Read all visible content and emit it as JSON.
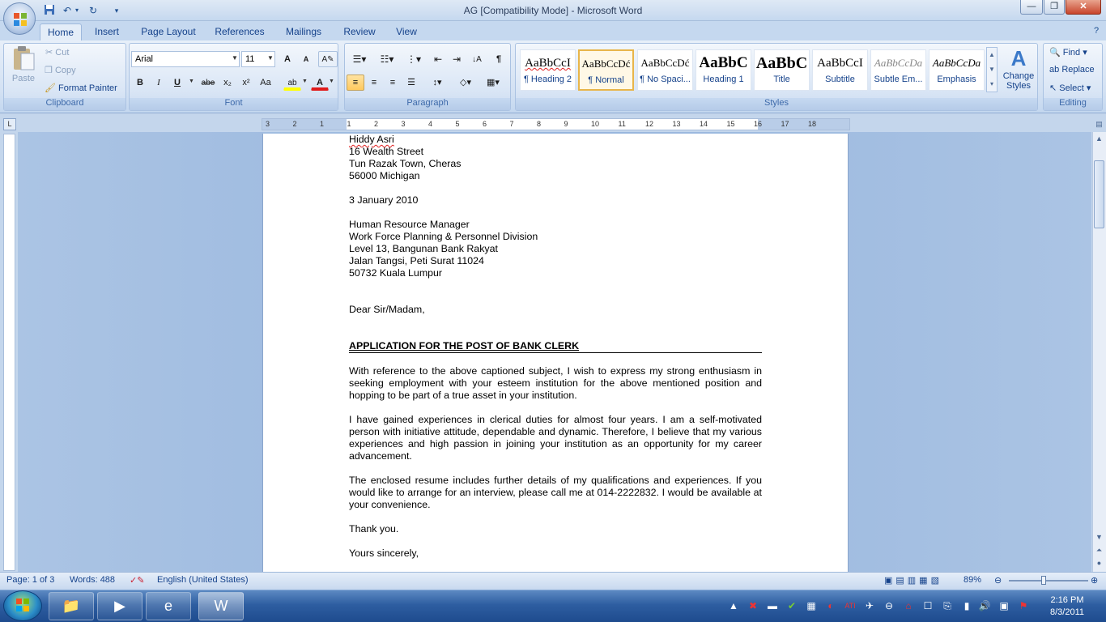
{
  "window": {
    "title": "AG [Compatibility Mode] - Microsoft Word",
    "minimize_glyph": "—",
    "restore_glyph": "❐",
    "close_glyph": "✕"
  },
  "qat": {
    "save_icon": "save-icon",
    "undo_glyph": "↶",
    "redo_glyph": "↻",
    "more_glyph": "▾"
  },
  "tabs": [
    "Home",
    "Insert",
    "Page Layout",
    "References",
    "Mailings",
    "Review",
    "View"
  ],
  "clipboard": {
    "paste": "Paste",
    "cut": "Cut",
    "copy": "Copy",
    "format_painter": "Format Painter",
    "label": "Clipboard"
  },
  "font": {
    "name": "Arial",
    "size": "11",
    "grow": "A",
    "shrink": "A",
    "bold": "B",
    "italic": "I",
    "underline": "U",
    "strike": "abe",
    "subscript": "x₂",
    "superscript": "x²",
    "change_case": "Aa",
    "highlight": "ab",
    "color": "A",
    "label": "Font"
  },
  "paragraph": {
    "label": "Paragraph",
    "pilcrow": "¶",
    "sort": "↓A"
  },
  "styles": {
    "items": [
      {
        "preview": "AaBbCcI",
        "name": "¶ Heading 2"
      },
      {
        "preview": "AaBbCcDć",
        "name": "¶ Normal"
      },
      {
        "preview": "AaBbCcDć",
        "name": "¶ No Spaci..."
      },
      {
        "preview": "AaBbC",
        "name": "Heading 1"
      },
      {
        "preview": "AaBbC",
        "name": "Title"
      },
      {
        "preview": "AaBbCcI",
        "name": "Subtitle"
      },
      {
        "preview": "AaBbCcDa",
        "name": "Subtle Em..."
      },
      {
        "preview": "AaBbCcDa",
        "name": "Emphasis"
      }
    ],
    "change_styles": "Change",
    "change_styles_2": "Styles",
    "label": "Styles"
  },
  "editing": {
    "find": "Find",
    "replace": "Replace",
    "select": "Select",
    "label": "Editing"
  },
  "ruler": {
    "corner": "L",
    "ticks": [
      "3",
      "2",
      "1",
      "1",
      "2",
      "3",
      "4",
      "5",
      "6",
      "7",
      "8",
      "9",
      "10",
      "11",
      "12",
      "13",
      "14",
      "15",
      "16",
      "17",
      "18"
    ]
  },
  "document": {
    "sender": [
      "Hiddy Asri",
      "16 Wealth Street",
      "Tun Razak Town, Cheras",
      "56000 Michigan"
    ],
    "date": "3 January 2010",
    "recipient": [
      "Human Resource Manager",
      "Work Force Planning & Personnel Division",
      "Level 13, Bangunan Bank Rakyat",
      "Jalan Tangsi, Peti Surat 11024",
      "50732 Kuala Lumpur"
    ],
    "salutation": "Dear Sir/Madam,",
    "subject": "APPLICATION FOR THE POST OF  BANK CLERK",
    "paragraphs": [
      "With reference to the above captioned subject, I wish to express my strong enthusiasm in seeking employment with your esteem institution for the above mentioned position and hopping to be part of a true asset in your institution.",
      "I have gained experiences in clerical duties for almost four years. I am a self-motivated person with initiative attitude, dependable and dynamic. Therefore, I believe that my various experiences and high passion in joining your institution as an opportunity for my career advancement.",
      "The enclosed resume includes further details of my qualifications and experiences. If you would like to arrange for an interview, please call me at 014-2222832. I would be available at your convenience."
    ],
    "thanks": "Thank you.",
    "closing": "Yours sincerely,"
  },
  "status": {
    "page": "Page: 1 of 3",
    "words": "Words: 488",
    "language": "English (United States)",
    "zoom": "89%",
    "zoom_level": 0.89
  },
  "taskbar": {
    "time": "2:16 PM",
    "date": "8/3/2011"
  }
}
